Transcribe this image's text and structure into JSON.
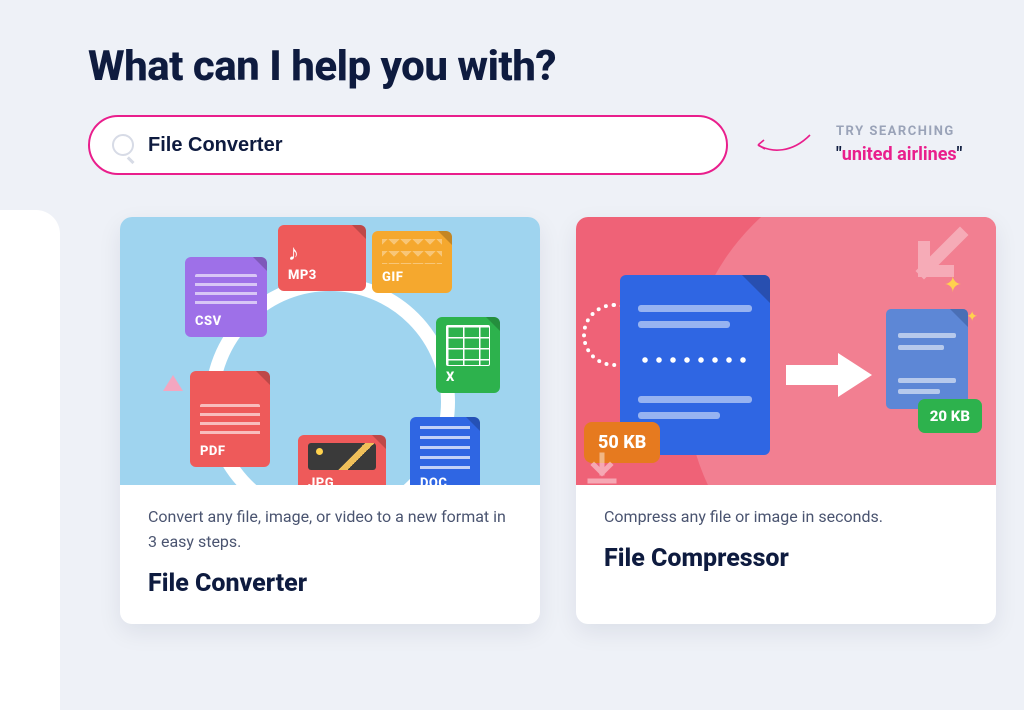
{
  "page": {
    "title": "What can I help you with?"
  },
  "search": {
    "value": "File Converter",
    "placeholder": ""
  },
  "hint": {
    "label": "TRY SEARCHING",
    "quote_open": "\"",
    "keyword": "united airlines",
    "quote_close": "\""
  },
  "cards": [
    {
      "description": "Convert any file, image, or video to a new format in 3 easy steps.",
      "title": "File Converter",
      "tiles": {
        "csv": "CSV",
        "mp3": "MP3",
        "gif": "GIF",
        "xls": "X",
        "doc": "DOC",
        "jpg": "JPG",
        "pdf": "PDF"
      }
    },
    {
      "description": "Compress any file or image in seconds.",
      "title": "File Compressor",
      "badges": {
        "before": "50 KB",
        "after": "20 KB"
      }
    }
  ]
}
